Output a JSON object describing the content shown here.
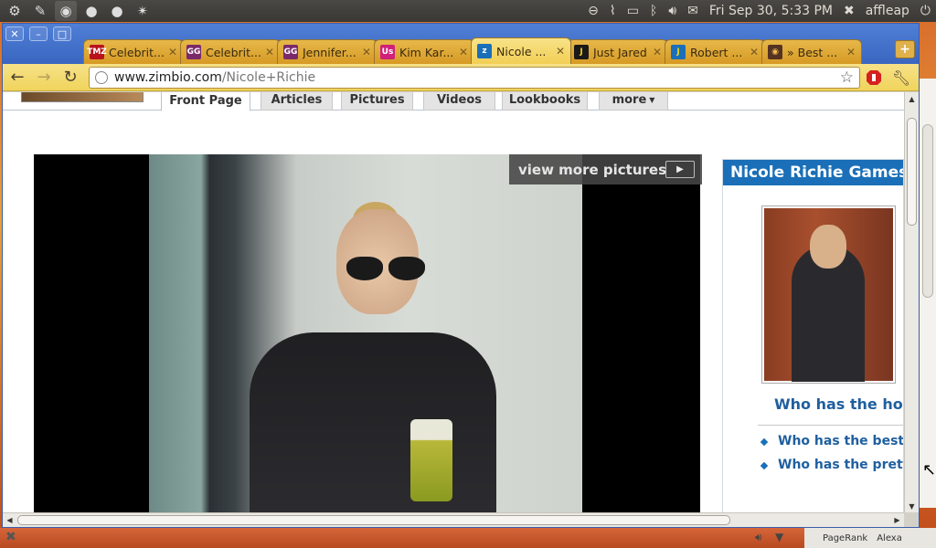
{
  "top_panel": {
    "clock": "Fri Sep 30,  5:33 PM",
    "user": "affleap"
  },
  "browser": {
    "tabs": [
      {
        "title": "Celebrit...",
        "favicon_text": "TMZ",
        "favicon_color": "#b8131c"
      },
      {
        "title": "Celebrit...",
        "favicon_text": "GG",
        "favicon_color": "#7a2a6a"
      },
      {
        "title": "Jennifer...",
        "favicon_text": "GG",
        "favicon_color": "#7a2a6a"
      },
      {
        "title": "Kim Kar...",
        "favicon_text": "Us",
        "favicon_color": "#d0207a"
      },
      {
        "title": "Nicole ...",
        "favicon_text": "z",
        "favicon_color": "#1a6fb8"
      },
      {
        "title": "Just Jared",
        "favicon_text": "J",
        "favicon_color": "#1a1a1a"
      },
      {
        "title": "Robert ...",
        "favicon_text": "J",
        "favicon_color": "#1a6fb8"
      },
      {
        "title": "» Best ...",
        "favicon_text": "◉",
        "favicon_color": "#553322"
      }
    ],
    "active_tab_index": 4,
    "url_domain": "www.zimbio.com",
    "url_path": "/Nicole+Richie"
  },
  "page": {
    "nav_tabs": [
      "Front Page",
      "Articles",
      "Pictures",
      "Videos",
      "Lookbooks",
      "more"
    ],
    "active_nav": "Front Page",
    "view_more_label": "view more pictures",
    "sidebar": {
      "title": "Nicole Richie Games",
      "question": "Who has the hotte",
      "links": [
        "Who has the best sn",
        "Who has the pretties"
      ]
    }
  },
  "bottom_panel": {
    "items": [
      "PageRank",
      "Alexa"
    ]
  },
  "colors": {
    "accent": "#1a6fb8",
    "tab_active": "#f2cf55",
    "titlebar": "#3a66c0"
  }
}
